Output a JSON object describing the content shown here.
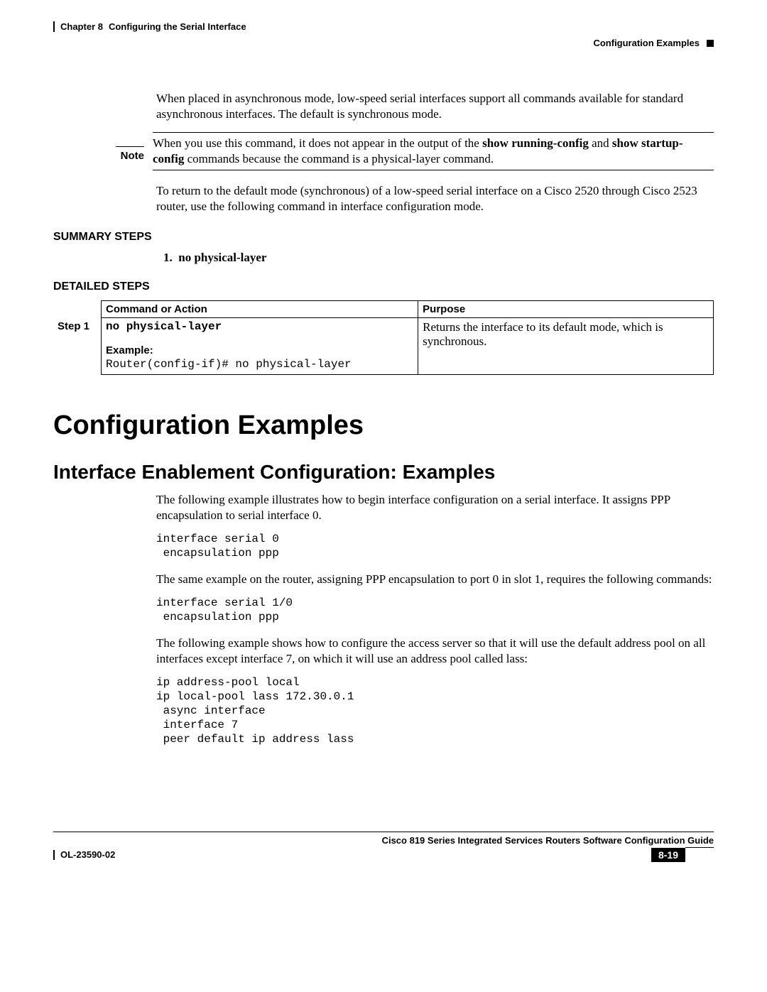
{
  "header": {
    "chapter": "Chapter 8",
    "chapter_title": "Configuring the Serial Interface",
    "section": "Configuration Examples"
  },
  "body": {
    "para1": "When placed in asynchronous mode, low-speed serial interfaces support all commands available for standard asynchronous interfaces. The default is synchronous mode.",
    "note_label": "Note",
    "note_text_1": "When you use this command, it does not appear in the output of the ",
    "note_cmd_1": "show running-config",
    "note_text_2": " and ",
    "note_cmd_2": "show startup-config",
    "note_text_3": " commands because the command is a physical-layer command.",
    "para2": "To return to the default mode (synchronous) of a low-speed serial interface on a Cisco 2520 through Cisco 2523 router, use the following command in interface configuration mode."
  },
  "summary": {
    "heading": "SUMMARY STEPS",
    "items": [
      {
        "num": "1.",
        "cmd": "no physical-layer"
      }
    ]
  },
  "detailed": {
    "heading": "DETAILED STEPS",
    "col1": "Command or Action",
    "col2": "Purpose",
    "step_label": "Step 1",
    "command": "no physical-layer",
    "example_label": "Example:",
    "example_code": "Router(config-if)# no physical-layer",
    "purpose": "Returns the interface to its default mode, which is synchronous."
  },
  "sections": {
    "h1": "Configuration Examples",
    "h2": "Interface Enablement Configuration: Examples",
    "para1": "The following example illustrates how to begin interface configuration on a serial interface. It assigns PPP encapsulation to serial interface 0.",
    "code1": "interface serial 0\n encapsulation ppp",
    "para2": "The same example on the router, assigning PPP encapsulation to port 0 in slot 1, requires the following commands:",
    "code2": "interface serial 1/0\n encapsulation ppp",
    "para3": "The following example shows how to configure the access server so that it will use the default address pool on all interfaces except interface 7, on which it will use an address pool called lass:",
    "code3": "ip address-pool local\nip local-pool lass 172.30.0.1\n async interface\n interface 7\n peer default ip address lass"
  },
  "footer": {
    "guide": "Cisco 819 Series Integrated Services Routers Software Configuration Guide",
    "docid": "OL-23590-02",
    "pagenum": "8-19"
  }
}
